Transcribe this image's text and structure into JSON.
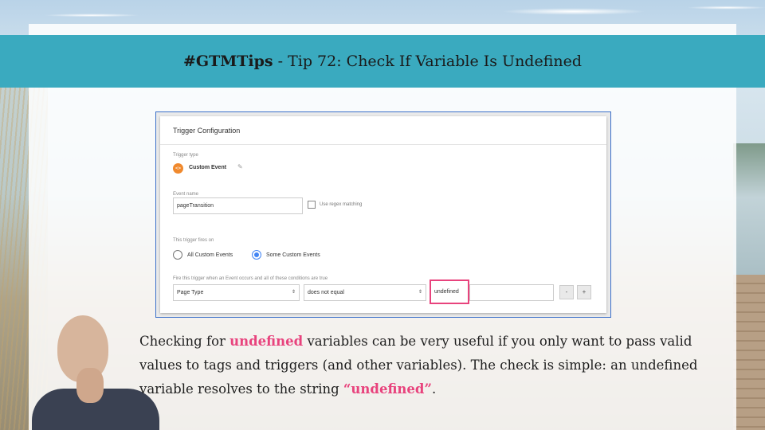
{
  "banner": {
    "hashtag": "#GTMTips",
    "rest": " - Tip 72: Check If Variable Is Undefined"
  },
  "trigger_config": {
    "title": "Trigger Configuration",
    "trigger_type_label": "Trigger type",
    "trigger_type_value": "Custom Event",
    "trigger_type_icon": "code-brackets-icon",
    "event_name_label": "Event name",
    "event_name_value": "pageTransition",
    "regex_label": "Use regex matching",
    "fires_on_label": "This trigger fires on",
    "option_all": "All Custom Events",
    "option_some": "Some Custom Events",
    "selected_option": "Some Custom Events",
    "conditions_label": "Fire this trigger when an Event occurs and all of these conditions are true",
    "condition": {
      "variable": "Page Type",
      "operator": "does not equal",
      "value": "undefined"
    },
    "minus_label": "-",
    "plus_label": "+"
  },
  "caption": {
    "part1": "Checking for ",
    "highlight1": "undefined",
    "part2": " variables can be very useful if you only want to pass valid values to tags and triggers (and other variables). The check is simple: an undefined variable resolves to the string ",
    "highlight2": "“undefined”",
    "part3": "."
  },
  "colors": {
    "banner": "#3aaabf",
    "accent": "#e8437d",
    "radio_selected": "#4285f4",
    "custom_event_icon": "#f0892d"
  }
}
